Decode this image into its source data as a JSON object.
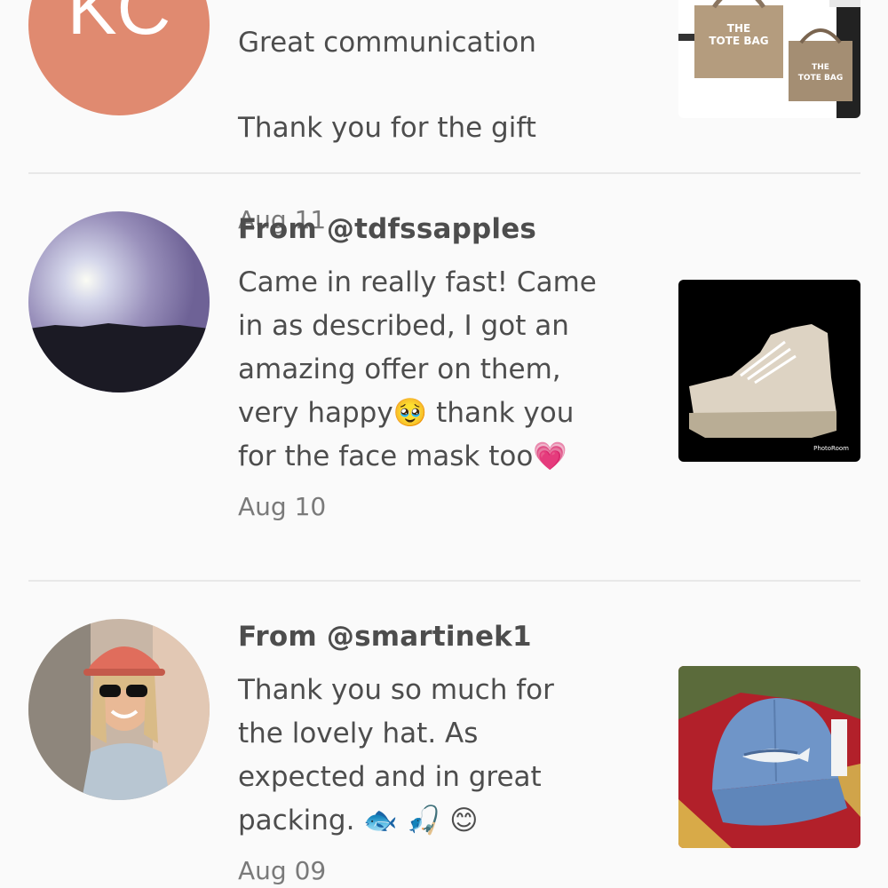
{
  "reviews": [
    {
      "avatar_initials": "KC",
      "avatar_color": "#e08a70",
      "body_partial_top": "Great communication",
      "body_last": "Thank you for the gift",
      "date": "Aug 11",
      "thumb": {
        "label_1": "THE",
        "label_2": "TOTE BAG",
        "label_3": "THE",
        "label_4": "TOTE BAG"
      }
    },
    {
      "from": "From @tdfssapples",
      "body": "Came in really fast! Came\nin as described, I got an\namazing offer on them,\nvery happy🥹 thank you\nfor the face mask too💗",
      "date": "Aug 10",
      "thumb": {
        "watermark": "PhotoRoom"
      }
    },
    {
      "from": "From @smartinek1",
      "body": "Thank you so much for\nthe lovely hat. As\nexpected and in great\npacking. 🐟 🎣 😊",
      "date": "Aug 09"
    }
  ]
}
